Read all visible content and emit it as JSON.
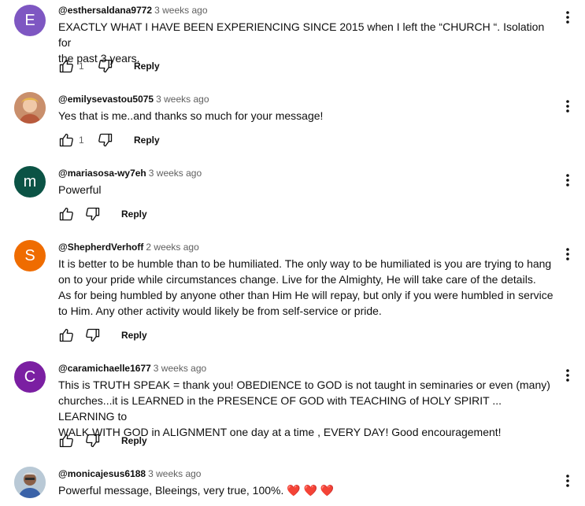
{
  "reply_label": "Reply",
  "colors": {
    "avatar_e": "#7e57c2",
    "avatar_m": "#0b5345",
    "avatar_s": "#ef6c00",
    "avatar_c": "#7b1fa2"
  },
  "comments": [
    {
      "author": "@esthersaldana9772",
      "time": "3 weeks ago",
      "text": "EXACTLY WHAT I HAVE BEEN EXPERIENCING SINCE 2015 when I left the “CHURCH “.  Isolation for\nthe past 3 years.",
      "likes": "1",
      "avatar_letter": "E",
      "avatar_icon": "letter-avatar"
    },
    {
      "author": "@emilysevastou5075",
      "time": "3 weeks ago",
      "text": "Yes that is me..and thanks so much for your message!",
      "likes": "1",
      "avatar_icon": "photo-avatar"
    },
    {
      "author": "@mariasosa-wy7eh",
      "time": "3 weeks ago",
      "text": "Powerful",
      "likes": "",
      "avatar_letter": "m",
      "avatar_icon": "letter-avatar"
    },
    {
      "author": "@ShepherdVerhoff",
      "time": "2 weeks ago",
      "text": "It is better to be humble than to be humiliated. The only way to be humiliated is you are trying to hang\non to your pride while circumstances change. Live for the Almighty, He will take care of the details.\nAs for being humbled by anyone other than Him He will repay, but only if you were humbled in service\nto Him. Any other activity would likely be from self-service or pride.",
      "likes": "",
      "avatar_letter": "S",
      "avatar_icon": "letter-avatar"
    },
    {
      "author": "@caramichaelle1677",
      "time": "3 weeks ago",
      "text": "This is TRUTH SPEAK = thank you! OBEDIENCE to GOD is not taught in seminaries or even (many)\nchurches...it is LEARNED in the PRESENCE OF GOD with TEACHING of HOLY SPIRIT ... LEARNING to\nWALK WITH GOD in ALIGNMENT one day at a time , EVERY DAY! Good encouragement!",
      "likes": "",
      "avatar_letter": "C",
      "avatar_icon": "letter-avatar"
    },
    {
      "author": "@monicajesus6188",
      "time": "3 weeks ago",
      "text": "Powerful message, Bleeings, very true, 100%.",
      "hearts": "❤️ ❤️ ❤️",
      "likes": "",
      "avatar_icon": "photo-avatar"
    }
  ]
}
